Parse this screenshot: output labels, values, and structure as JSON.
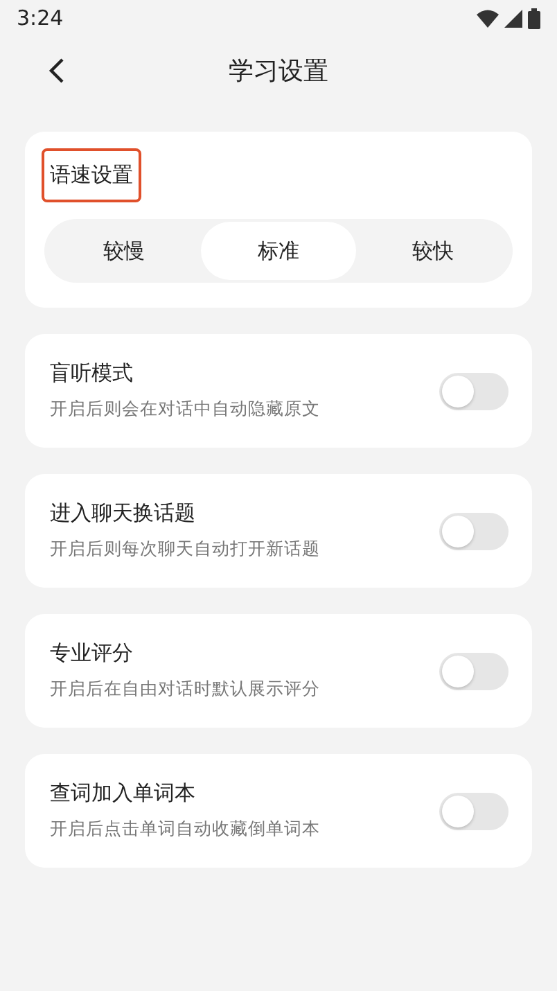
{
  "status_bar": {
    "time": "3:24"
  },
  "header": {
    "title": "学习设置"
  },
  "speed": {
    "title": "语速设置",
    "highlighted": true,
    "options": [
      {
        "label": "较慢",
        "selected": false
      },
      {
        "label": "标准",
        "selected": true
      },
      {
        "label": "较快",
        "selected": false
      }
    ]
  },
  "settings": [
    {
      "title": "盲听模式",
      "description": "开启后则会在对话中自动隐藏原文",
      "on": false
    },
    {
      "title": "进入聊天换话题",
      "description": "开启后则每次聊天自动打开新话题",
      "on": false
    },
    {
      "title": "专业评分",
      "description": "开启后在自由对话时默认展示评分",
      "on": false
    },
    {
      "title": "查词加入单词本",
      "description": "开启后点击单词自动收藏倒单词本",
      "on": false
    }
  ]
}
